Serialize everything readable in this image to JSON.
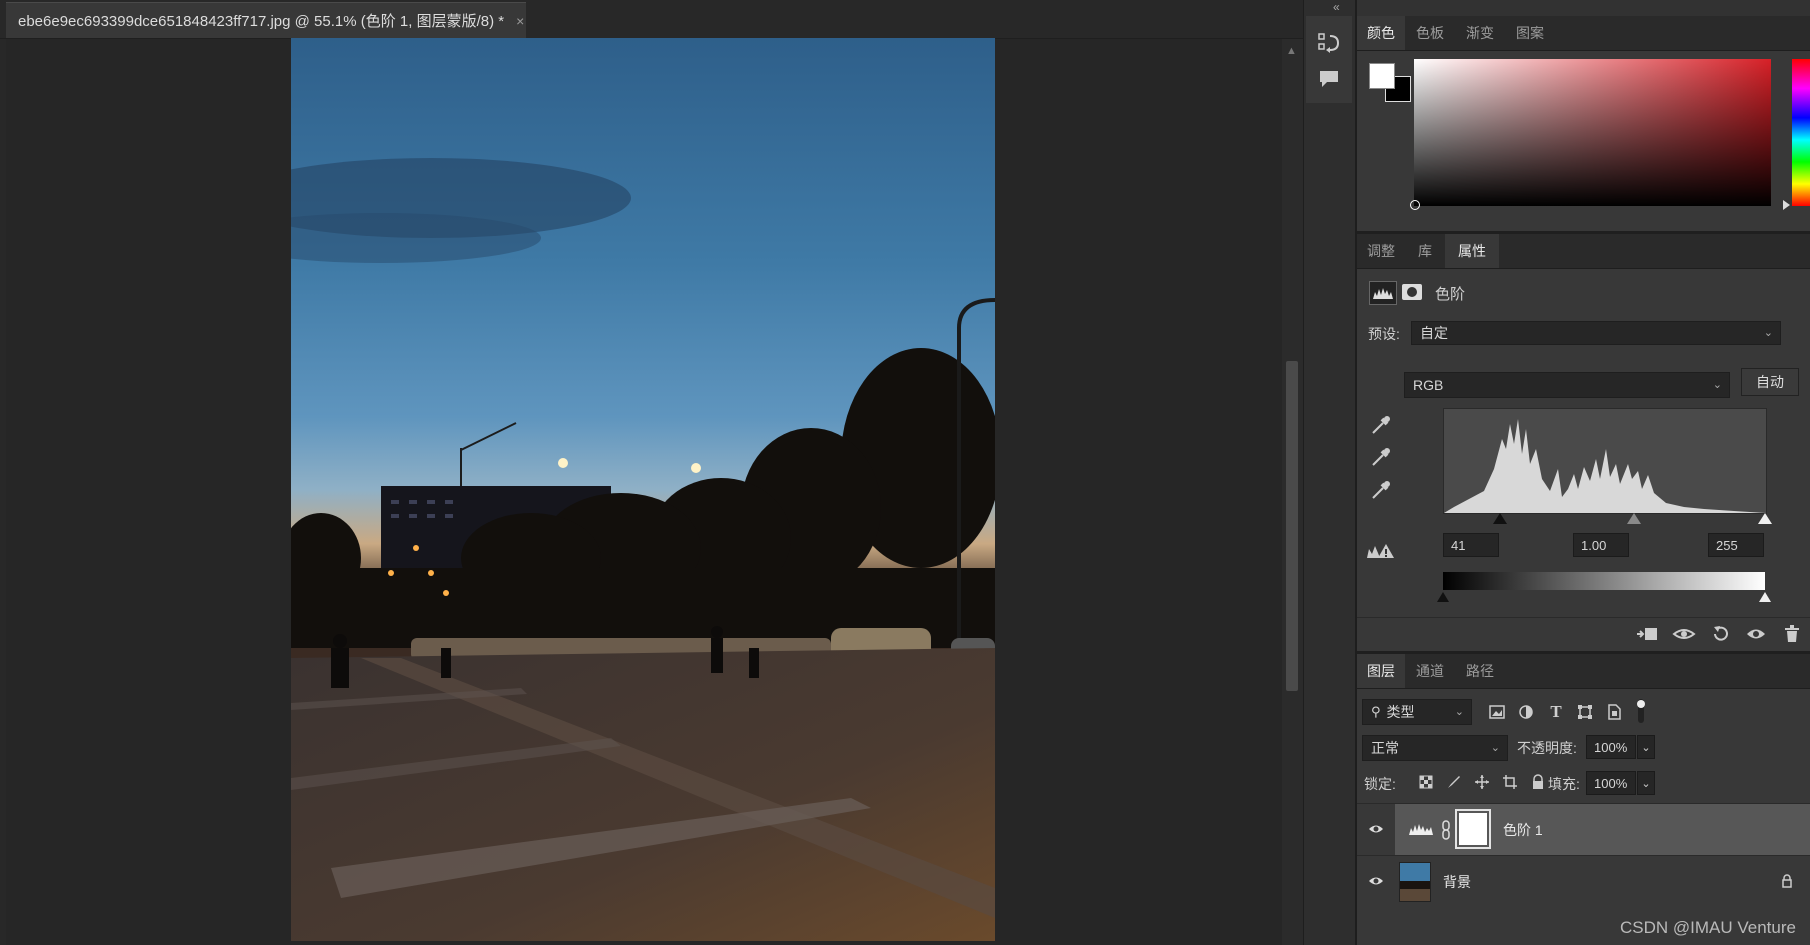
{
  "document": {
    "tab_title": "ebe6e9ec693399dce651848423ff717.jpg @ 55.1% (色阶 1, 图层蒙版/8) *",
    "close_glyph": "×"
  },
  "color_panel": {
    "tabs": [
      "颜色",
      "色板",
      "渐变",
      "图案"
    ],
    "active_tab": 0,
    "foreground_color": "#ffffff",
    "background_color": "#000000",
    "hue_color": "#d72027"
  },
  "properties_panel": {
    "tabs": [
      "调整",
      "库",
      "属性"
    ],
    "active_tab": 2,
    "adjustment_name": "色阶",
    "preset_label": "预设:",
    "preset_value": "自定",
    "channel_value": "RGB",
    "auto_button": "自动",
    "input_black": "41",
    "input_gamma": "1.00",
    "input_white": "255"
  },
  "layers_panel": {
    "tabs": [
      "图层",
      "通道",
      "路径"
    ],
    "active_tab": 0,
    "filter_type": "类型",
    "blend_mode": "正常",
    "opacity_label": "不透明度:",
    "opacity_value": "100%",
    "lock_label": "锁定:",
    "fill_label": "填充:",
    "fill_value": "100%",
    "layers": [
      {
        "name": "色阶 1",
        "type": "adjustment",
        "visible": true,
        "selected": true
      },
      {
        "name": "背景",
        "type": "image",
        "visible": true,
        "locked": true
      }
    ]
  },
  "watermark": "CSDN @IMAU Venture",
  "icons": {
    "collapse": "double-chevron-icon",
    "history": "history-icon",
    "comment": "comment-icon"
  }
}
